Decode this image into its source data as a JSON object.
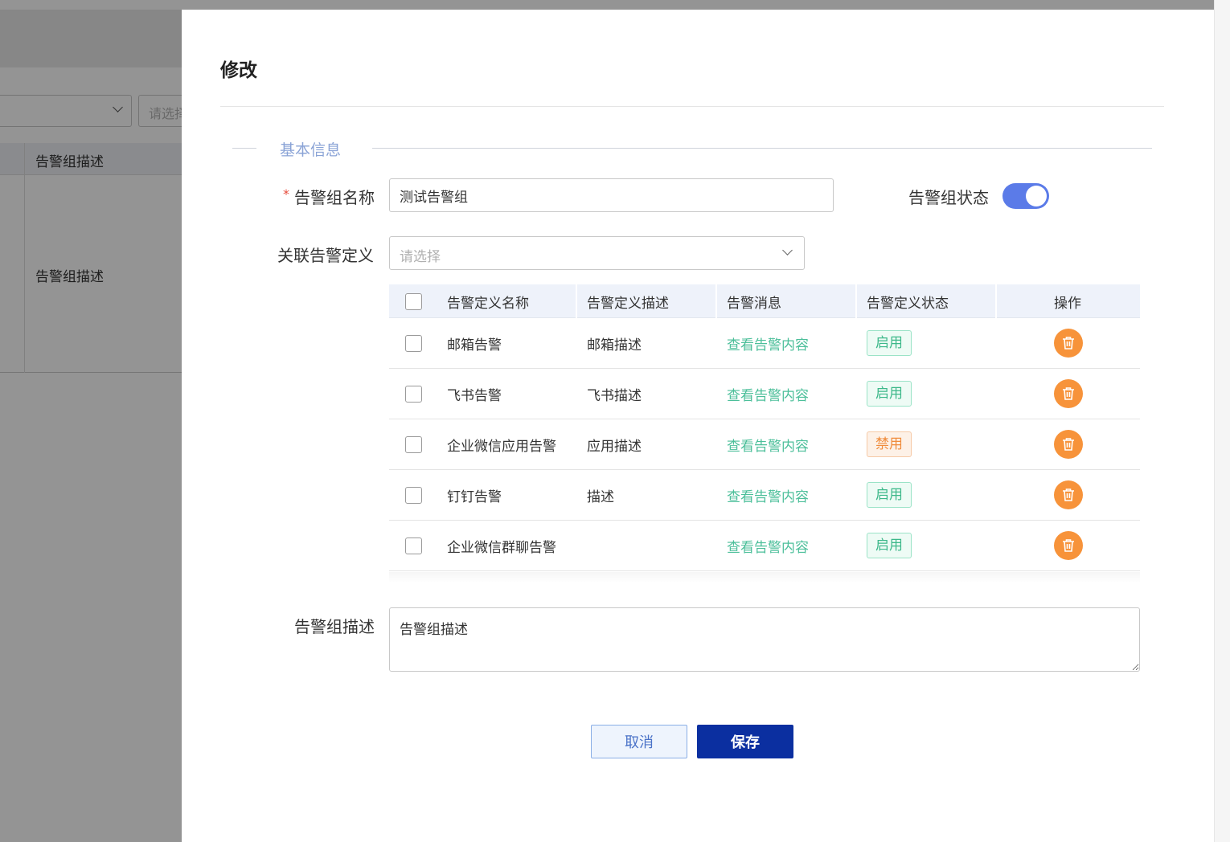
{
  "background": {
    "filter_placeholder": "请选择",
    "table_header": "告警组描述",
    "table_cell": "告警组描述"
  },
  "drawer": {
    "title": "修改",
    "section_title": "基本信息",
    "form": {
      "name_label": "告警组名称",
      "name_required_mark": "*",
      "name_value": "测试告警组",
      "status_label": "告警组状态",
      "status_on": true,
      "definition_label": "关联告警定义",
      "definition_placeholder": "请选择",
      "description_label": "告警组描述",
      "description_value": "告警组描述"
    },
    "table": {
      "headers": [
        "告警定义名称",
        "告警定义描述",
        "告警消息",
        "告警定义状态",
        "操作"
      ],
      "rows": [
        {
          "name": "邮箱告警",
          "desc": "邮箱描述",
          "message": "查看告警内容",
          "status": "启用",
          "enabled": true
        },
        {
          "name": "飞书告警",
          "desc": "飞书描述",
          "message": "查看告警内容",
          "status": "启用",
          "enabled": true
        },
        {
          "name": "企业微信应用告警",
          "desc": "应用描述",
          "message": "查看告警内容",
          "status": "禁用",
          "enabled": false
        },
        {
          "name": "钉钉告警",
          "desc": "描述",
          "message": "查看告警内容",
          "status": "启用",
          "enabled": true
        },
        {
          "name": "企业微信群聊告警",
          "desc": "",
          "message": "查看告警内容",
          "status": "启用",
          "enabled": true
        }
      ]
    },
    "buttons": {
      "cancel": "取消",
      "save": "保存"
    }
  },
  "colors": {
    "accent": "#5b7be8",
    "primary_button": "#0b2fa0",
    "link": "#4cbf9a",
    "delete": "#f7933a",
    "enabled_tag": "#3db88a",
    "disabled_tag": "#f08c3c"
  },
  "icons": {
    "delete": "trash-icon",
    "dropdown": "chevron-down-icon"
  }
}
